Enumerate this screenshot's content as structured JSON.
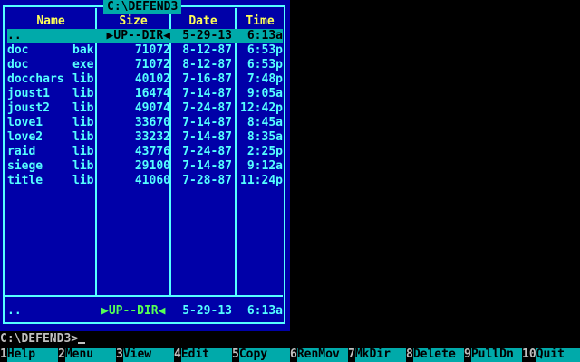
{
  "panel": {
    "path": "C:\\DEFEND3",
    "headers": {
      "name": "Name",
      "size": "Size",
      "date": "Date",
      "time": "Time"
    },
    "rows": [
      {
        "name": "..",
        "ext": "",
        "size": "▶UP--DIR◀",
        "date": "5-29-13",
        "time": "6:13a",
        "selected": true
      },
      {
        "name": "doc",
        "ext": "bak",
        "size": "71072",
        "date": "8-12-87",
        "time": "6:53p"
      },
      {
        "name": "doc",
        "ext": "exe",
        "size": "71072",
        "date": "8-12-87",
        "time": "6:53p"
      },
      {
        "name": "docchars",
        "ext": "lib",
        "size": "40102",
        "date": "7-16-87",
        "time": "7:48p"
      },
      {
        "name": "joust1",
        "ext": "lib",
        "size": "16474",
        "date": "7-14-87",
        "time": "9:05a"
      },
      {
        "name": "joust2",
        "ext": "lib",
        "size": "49074",
        "date": "7-24-87",
        "time": "12:42p"
      },
      {
        "name": "love1",
        "ext": "lib",
        "size": "33670",
        "date": "7-14-87",
        "time": "8:45a"
      },
      {
        "name": "love2",
        "ext": "lib",
        "size": "33232",
        "date": "7-14-87",
        "time": "8:35a"
      },
      {
        "name": "raid",
        "ext": "lib",
        "size": "43776",
        "date": "7-24-87",
        "time": "2:25p"
      },
      {
        "name": "siege",
        "ext": "lib",
        "size": "29100",
        "date": "7-14-87",
        "time": "9:12a"
      },
      {
        "name": "title",
        "ext": "lib",
        "size": "41060",
        "date": "7-28-87",
        "time": "11:24p"
      }
    ],
    "footer": {
      "name": "..",
      "size": "▶UP--DIR◀",
      "date": "5-29-13",
      "time": "6:13a"
    }
  },
  "command_line": {
    "prompt": "C:\\DEFEND3>"
  },
  "keybar": [
    {
      "num": "1",
      "label": "Help"
    },
    {
      "num": "2",
      "label": "Menu"
    },
    {
      "num": "3",
      "label": "View"
    },
    {
      "num": "4",
      "label": "Edit"
    },
    {
      "num": "5",
      "label": "Copy"
    },
    {
      "num": "6",
      "label": "RenMov"
    },
    {
      "num": "7",
      "label": "MkDir"
    },
    {
      "num": "8",
      "label": "Delete"
    },
    {
      "num": "9",
      "label": "PullDn"
    },
    {
      "num": "10",
      "label": "Quit"
    }
  ],
  "colors": {
    "panel_bg": "#0000a8",
    "frame": "#55ffff",
    "header_text": "#ffff55",
    "selection_bg": "#00aaaa",
    "updir_text": "#55ff55"
  }
}
